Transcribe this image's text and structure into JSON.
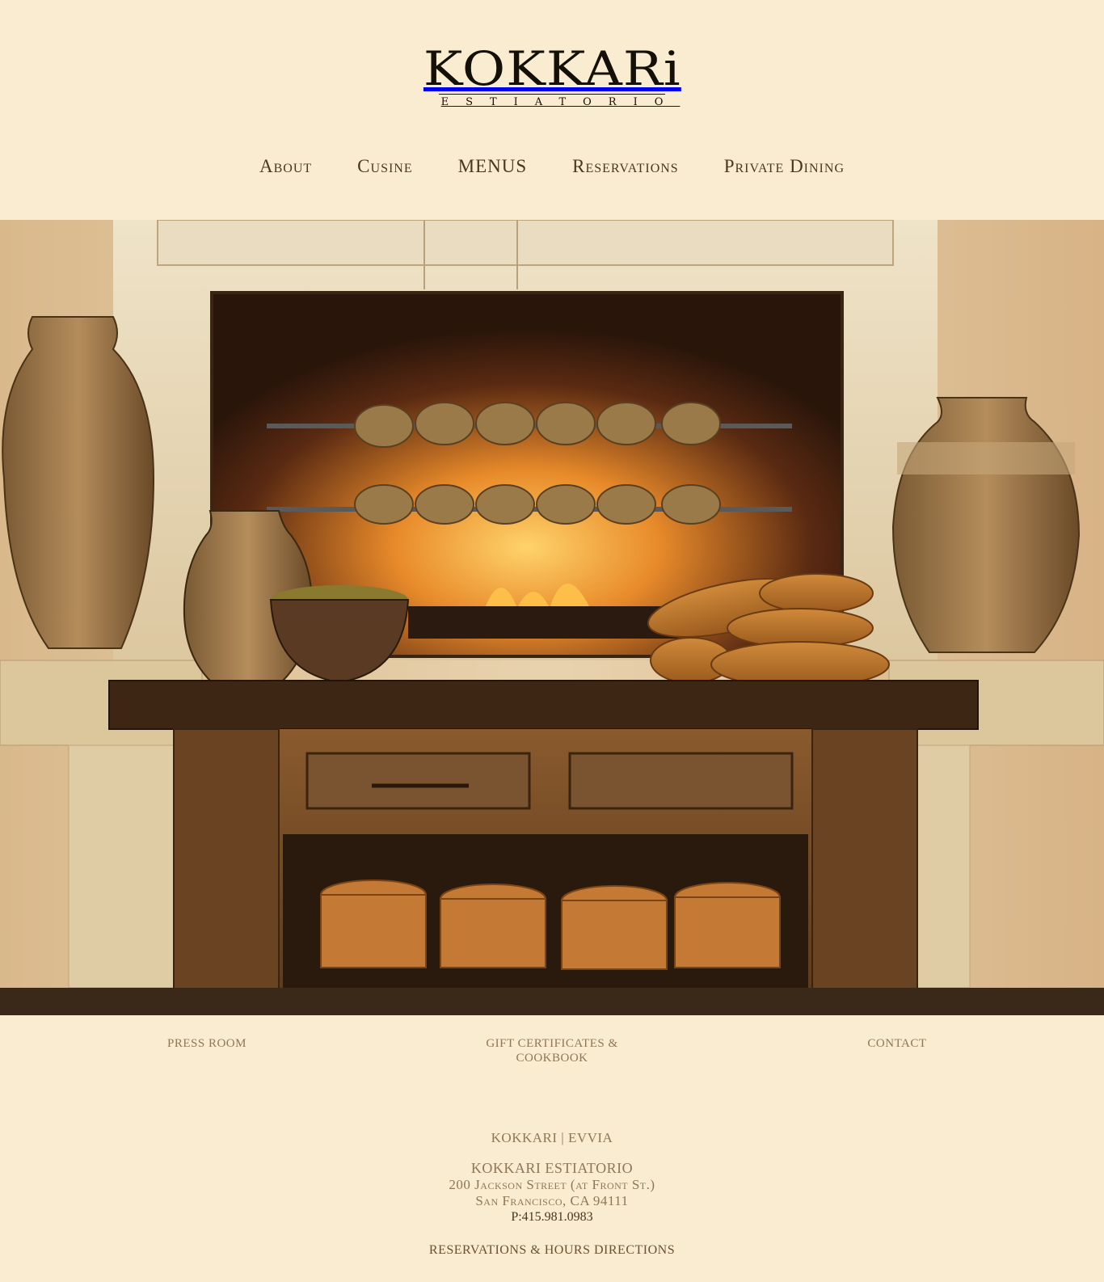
{
  "brand": {
    "name": "KOKKARi",
    "subtitle": "ESTIATORIO"
  },
  "nav": {
    "items": [
      {
        "label": "About"
      },
      {
        "label": "Cusine"
      },
      {
        "label": "MENUS"
      },
      {
        "label": "Reservations"
      },
      {
        "label": "Private Dining"
      }
    ]
  },
  "footer_links": {
    "press": "PRESS ROOM",
    "gift": "GIFT CERTIFICATES & COOKBOOK",
    "contact": "CONTACT"
  },
  "address": {
    "brand_kokkari": "KOKKARI",
    "separator": " | ",
    "brand_evvia": "EVVIA",
    "name": "KOKKARI ESTIATORIO",
    "street": "200 Jackson Street (at Front St.)",
    "city": "San Francisco, CA 94111",
    "phone": "P:415.981.0983",
    "reservations_link": "RESERVATIONS & HOURS",
    "directions_link": "DIRECTIONS"
  },
  "colors": {
    "background": "#f9ecd0",
    "nav_text": "#4a3720",
    "footer_text": "#8f7755"
  }
}
